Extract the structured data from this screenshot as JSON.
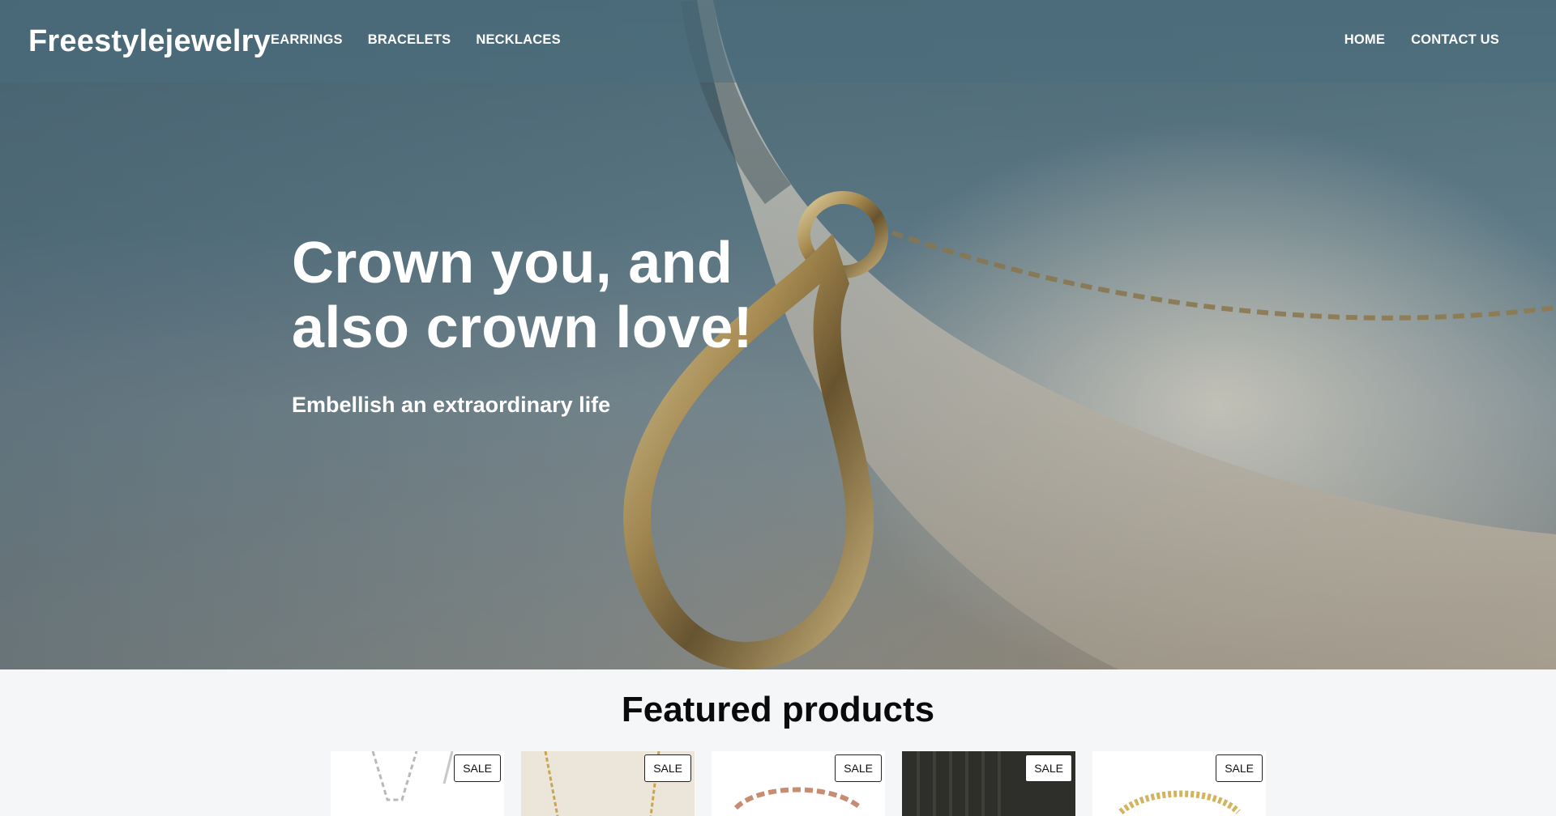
{
  "header": {
    "brand": "Freestylejewelry",
    "nav_left": [
      "EARRINGS",
      "BRACELETS",
      "NECKLACES"
    ],
    "nav_right": [
      "HOME",
      "CONTACT US"
    ]
  },
  "hero": {
    "title": "Crown you, and also crown love!",
    "subtitle": "Embellish an extraordinary life"
  },
  "featured": {
    "title": "Featured products",
    "products": [
      {
        "badge": "SALE"
      },
      {
        "badge": "SALE"
      },
      {
        "badge": "SALE"
      },
      {
        "badge": "SALE"
      },
      {
        "badge": "SALE"
      }
    ]
  }
}
